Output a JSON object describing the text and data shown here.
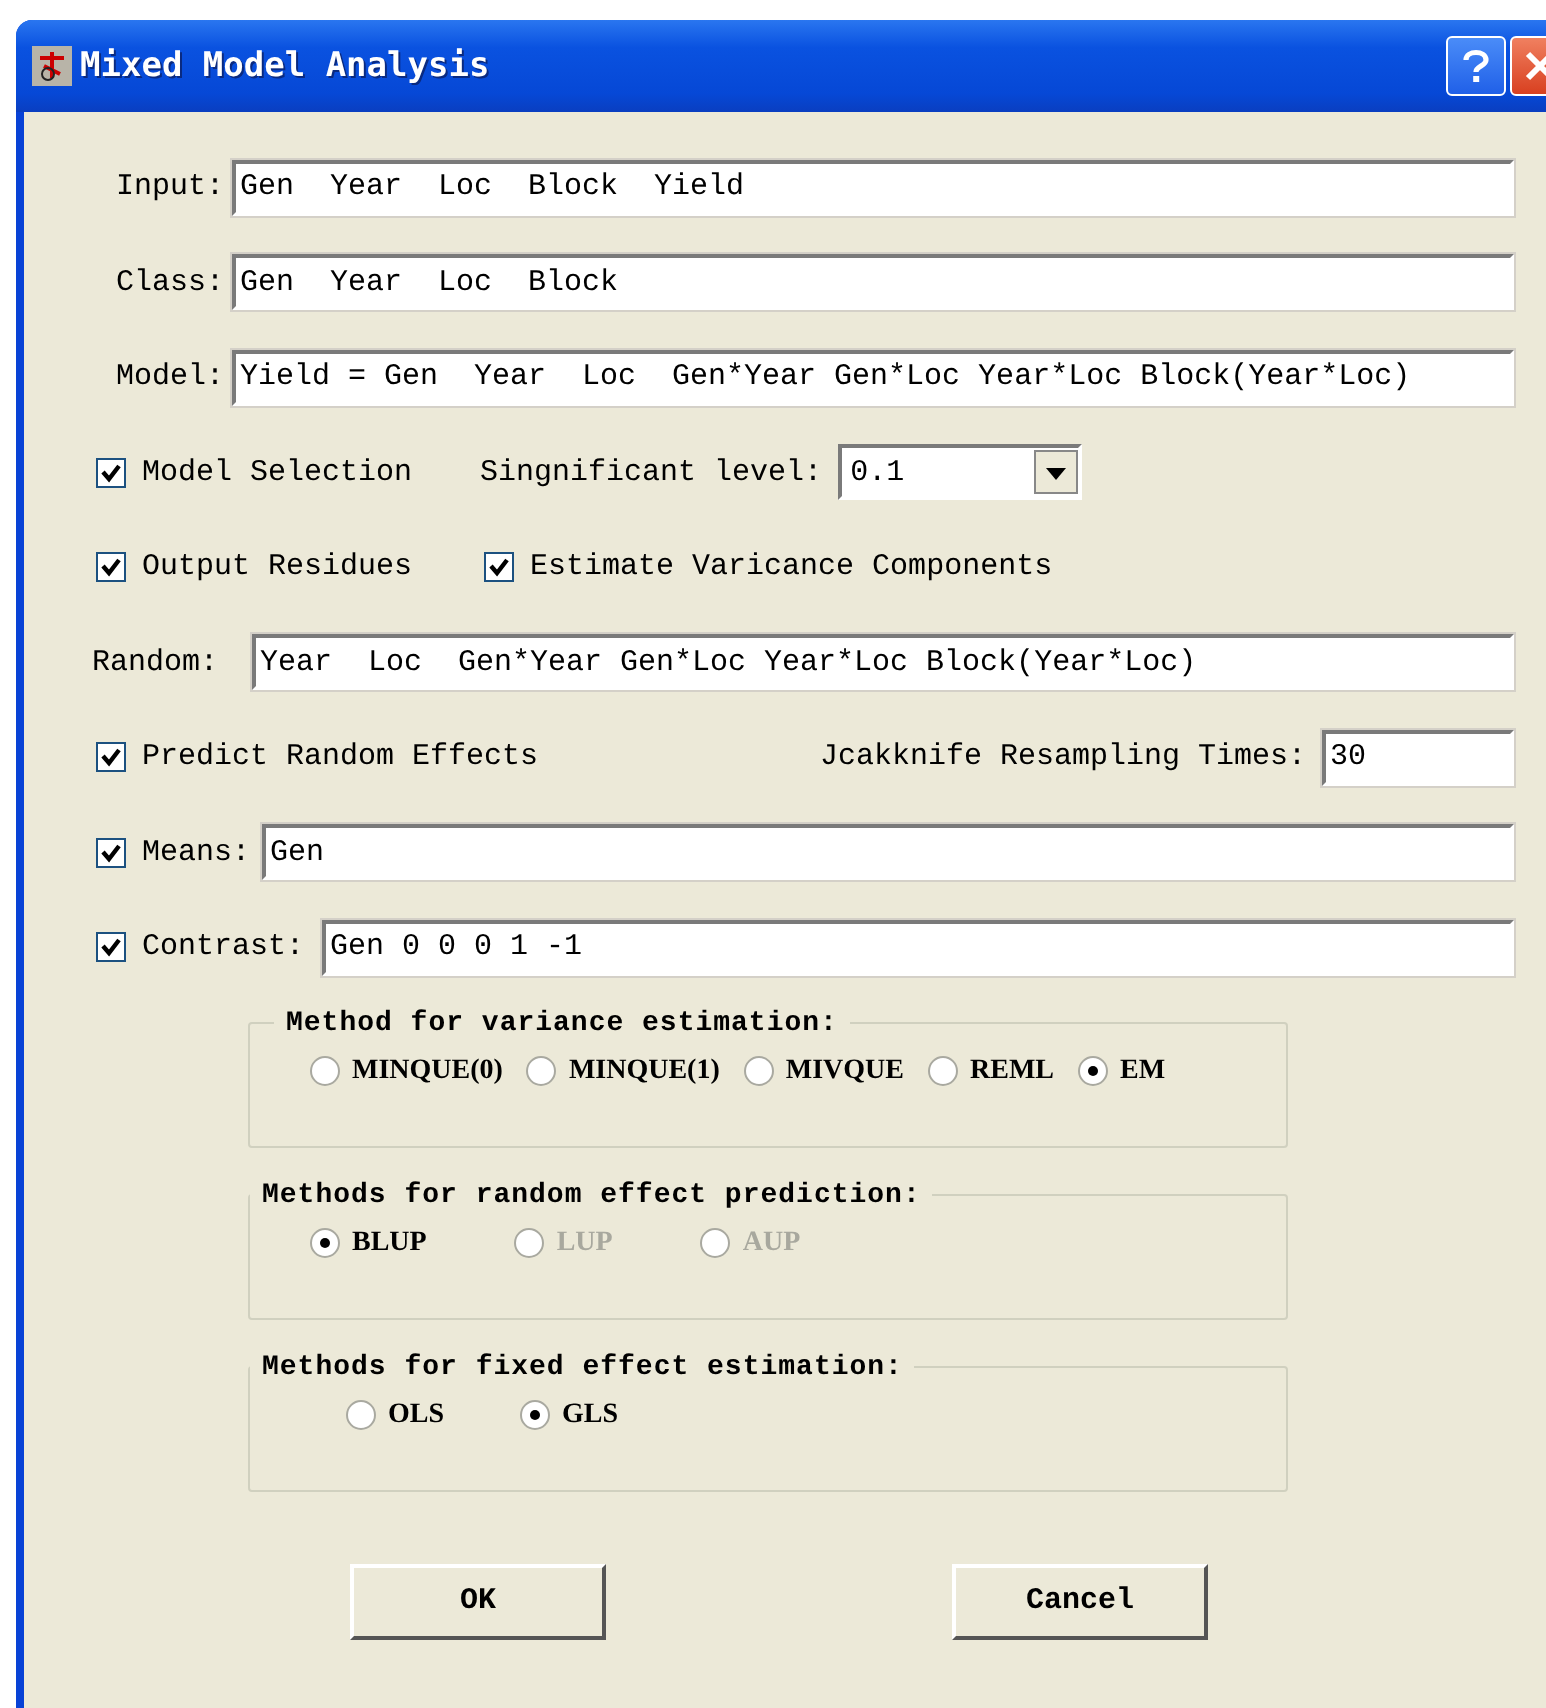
{
  "window": {
    "title": "Mixed Model Analysis"
  },
  "input": {
    "label": "Input:",
    "value": "Gen  Year  Loc  Block  Yield"
  },
  "class": {
    "label": "Class:",
    "value": "Gen  Year  Loc  Block"
  },
  "model": {
    "label": "Model:",
    "value": "Yield = Gen  Year  Loc  Gen*Year Gen*Loc Year*Loc Block(Year*Loc)"
  },
  "model_selection": {
    "label": "Model Selection",
    "checked": true
  },
  "significant_level": {
    "label": "Singnificant level:",
    "value": "0.1"
  },
  "output_residues": {
    "label": "Output Residues",
    "checked": true
  },
  "estimate_variance": {
    "label": "Estimate Varicance Components",
    "checked": true
  },
  "random": {
    "label": "Random:",
    "value": "Year  Loc  Gen*Year Gen*Loc Year*Loc Block(Year*Loc)"
  },
  "predict_random": {
    "label": "Predict Random Effects",
    "checked": true
  },
  "jackknife": {
    "label": "Jcakknife Resampling Times:",
    "value": "30"
  },
  "means": {
    "label": "Means:",
    "checked": true,
    "value": "Gen"
  },
  "contrast": {
    "label": "Contrast:",
    "checked": true,
    "value": "Gen 0 0 0 1 -1"
  },
  "groups": [
    {
      "title": "Method for variance estimation:",
      "options": [
        {
          "label": "MINQUE(0)",
          "selected": false,
          "disabled": false
        },
        {
          "label": "MINQUE(1)",
          "selected": false,
          "disabled": false
        },
        {
          "label": "MIVQUE",
          "selected": false,
          "disabled": false
        },
        {
          "label": "REML",
          "selected": false,
          "disabled": false
        },
        {
          "label": "EM",
          "selected": true,
          "disabled": false
        }
      ]
    },
    {
      "title": "Methods for random effect prediction:",
      "options": [
        {
          "label": "BLUP",
          "selected": true,
          "disabled": false
        },
        {
          "label": "LUP",
          "selected": false,
          "disabled": true
        },
        {
          "label": "AUP",
          "selected": false,
          "disabled": true
        }
      ]
    },
    {
      "title": "Methods for fixed effect estimation:",
      "options": [
        {
          "label": "OLS",
          "selected": false,
          "disabled": false
        },
        {
          "label": "GLS",
          "selected": true,
          "disabled": false
        }
      ]
    }
  ],
  "buttons": [
    "OK",
    "Cancel"
  ]
}
